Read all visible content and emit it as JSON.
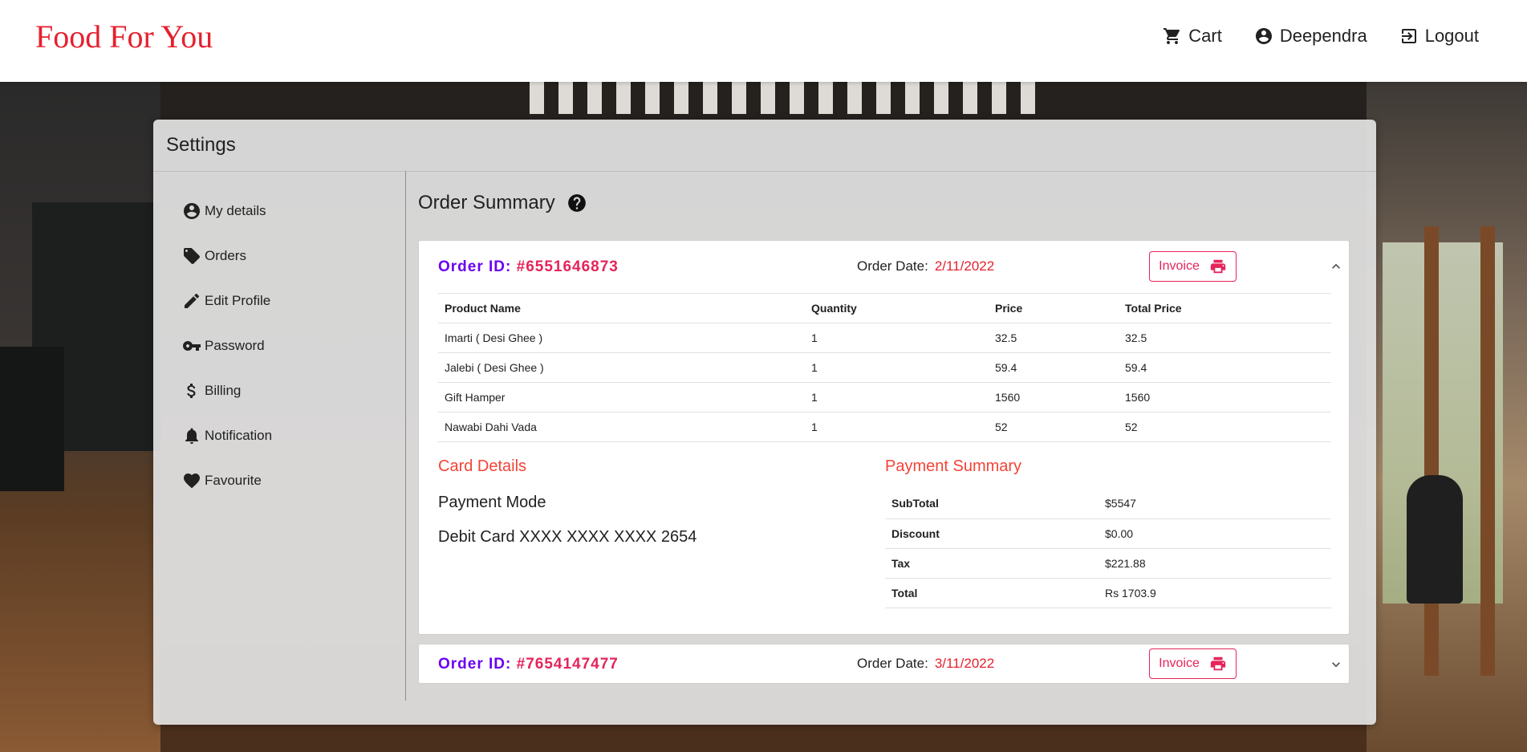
{
  "header": {
    "brand": "Food For You",
    "nav": [
      {
        "label": "Cart",
        "icon": "cart-icon"
      },
      {
        "label": "Deependra",
        "icon": "account-icon"
      },
      {
        "label": "Logout",
        "icon": "logout-icon"
      }
    ]
  },
  "settings": {
    "title": "Settings",
    "sidebar": [
      {
        "label": "My details",
        "icon": "account-circle-icon"
      },
      {
        "label": "Orders",
        "icon": "tag-icon"
      },
      {
        "label": "Edit Profile",
        "icon": "pencil-icon"
      },
      {
        "label": "Password",
        "icon": "key-icon"
      },
      {
        "label": "Billing",
        "icon": "dollar-icon"
      },
      {
        "label": "Notification",
        "icon": "bell-icon"
      },
      {
        "label": "Favourite",
        "icon": "heart-icon"
      }
    ]
  },
  "content": {
    "title": "Order Summary",
    "orders": [
      {
        "id_label": "Order ID:",
        "id": "#6551646873",
        "date_label": "Order Date:",
        "date": "2/11/2022",
        "invoice_label": "Invoice",
        "expanded": true,
        "columns": [
          "Product Name",
          "Quantity",
          "Price",
          "Total Price"
        ],
        "rows": [
          [
            "Imarti ( Desi Ghee )",
            "1",
            "32.5",
            "32.5"
          ],
          [
            "Jalebi ( Desi Ghee )",
            "1",
            "59.4",
            "59.4"
          ],
          [
            "Gift Hamper",
            "1",
            "1560",
            "1560"
          ],
          [
            "Nawabi Dahi Vada",
            "1",
            "52",
            "52"
          ]
        ],
        "card_details": {
          "title": "Card Details",
          "mode_label": "Payment Mode",
          "mode_value": "Debit Card XXXX XXXX XXXX 2654"
        },
        "payment_summary": {
          "title": "Payment Summary",
          "rows": [
            [
              "SubTotal",
              "$5547"
            ],
            [
              "Discount",
              "$0.00"
            ],
            [
              "Tax",
              "$221.88"
            ],
            [
              "Total",
              "Rs 1703.9"
            ]
          ]
        }
      },
      {
        "id_label": "Order ID:",
        "id": "#7654147477",
        "date_label": "Order Date:",
        "date": "3/11/2022",
        "invoice_label": "Invoice",
        "expanded": false
      }
    ]
  },
  "colors": {
    "brand": "#e5202e",
    "order_id_label": "#6a00f4",
    "order_id_value": "#e5245a",
    "section_title": "#f44336"
  }
}
